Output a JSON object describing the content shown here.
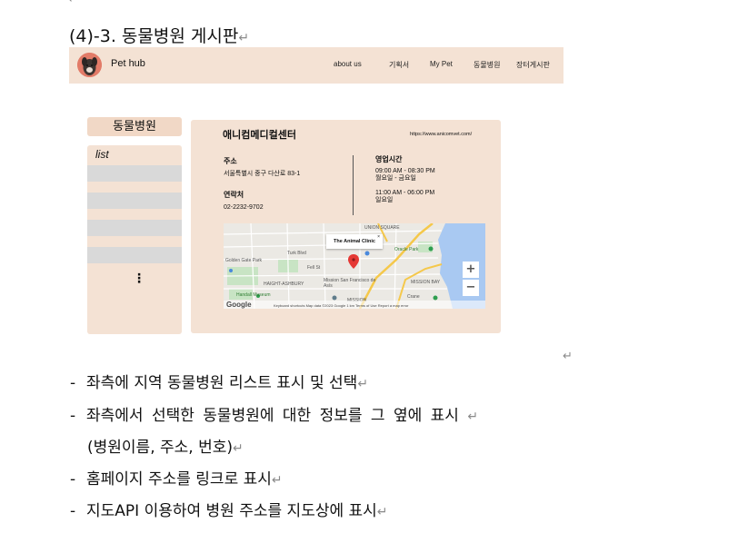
{
  "doc": {
    "return_mark": "↵",
    "heading": "(4)-3. 동물병원 게시판",
    "bullets": [
      "좌측에 지역 동물병원 리스트 표시 및 선택",
      "좌측에서 선택한 동물병원에 대한 정보를 그 옆에 표시",
      "홈페이지 주소를 링크로 표시",
      "지도API 이용하여 병원 주소를 지도상에 표시"
    ],
    "bullet2_continuation": "(병원이름, 주소, 번호)",
    "bullet_dash": "-"
  },
  "mockup": {
    "brand": "Pet hub",
    "nav": [
      "about us",
      "기획서",
      "My Pet",
      "동물병원",
      "장터게시판"
    ],
    "sidebar": {
      "title": "동물병원",
      "list_label": "list",
      "more": "⋮"
    },
    "detail": {
      "name": "애니컴메디컬센터",
      "url": "https://www.anicomvet.com/",
      "address_label": "주소",
      "address": "서울특별시 중구 다산로 83-1",
      "contact_label": "연락처",
      "phone": "02-2232-9702",
      "hours_label": "영업시간",
      "weekday_hours": "09:00 AM - 08:30 PM",
      "weekday_days": "월요일 - 금요일",
      "sunday_hours": "11:00 AM - 06:00 PM",
      "sunday_days": "일요일"
    },
    "map": {
      "popup": "The Animal Clinic",
      "popup_close": "×",
      "zoom_in": "+",
      "zoom_out": "−",
      "google": "Google",
      "attribution": "Keyboard shortcuts   Map data ©2023 Google   1 km        Terms of Use   Report a map error",
      "labels": [
        "UNION SQUARE",
        "Oracle Park",
        "MISSION BAY",
        "HAIGHT-ASHBURY",
        "Mission San Francisco de Asís",
        "Handall Museum",
        "Crane",
        "MISSION",
        "Turk Blvd",
        "Fell St",
        "Golden Gate Park"
      ]
    }
  }
}
